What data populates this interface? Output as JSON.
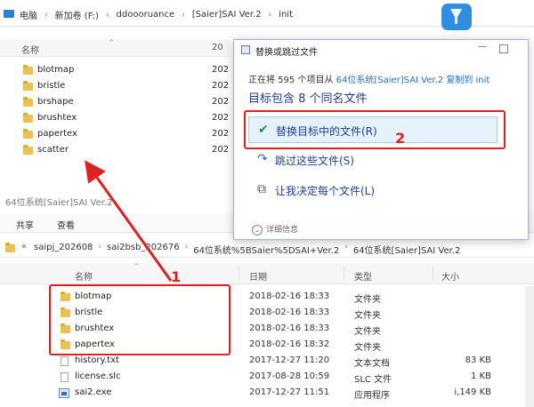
{
  "top_window": {
    "breadcrumb": [
      "电脑",
      "新加卷 (F:)",
      "ddoooruance",
      "[Saier]SAI Ver.2",
      "init"
    ],
    "header": {
      "name": "名称",
      "date": "20"
    },
    "rows": [
      {
        "name": "blotmap",
        "date": "202"
      },
      {
        "name": "bristle",
        "date": "202"
      },
      {
        "name": "brshape",
        "date": "202"
      },
      {
        "name": "brushtex",
        "date": "202"
      },
      {
        "name": "papertex",
        "date": "202"
      },
      {
        "name": "scatter",
        "date": "202"
      }
    ]
  },
  "bottom_window": {
    "title": "64位系统[Saier]SAI Ver.2",
    "ribbon_tabs": [
      "共享",
      "查看"
    ],
    "breadcrumb": [
      "saipj_202608",
      "sai2bsb_202676",
      "64位系统%5BSaier%5DSAI+Ver.2",
      "64位系统[Saier]SAI Ver.2"
    ],
    "headers": {
      "name": "名称",
      "date": "日期",
      "type": "类型",
      "size": "大小"
    },
    "rows": [
      {
        "name": "blotmap",
        "date": "2018-02-16 18:33",
        "type": "文件夹",
        "size": "",
        "kind": "folder"
      },
      {
        "name": "bristle",
        "date": "2018-02-16 18:33",
        "type": "文件夹",
        "size": "",
        "kind": "folder"
      },
      {
        "name": "brushtex",
        "date": "2018-02-16 18:33",
        "type": "文件夹",
        "size": "",
        "kind": "folder"
      },
      {
        "name": "papertex",
        "date": "2018-02-16 18:32",
        "type": "文件夹",
        "size": "",
        "kind": "folder"
      },
      {
        "name": "history.txt",
        "date": "2017-12-27 11:20",
        "type": "文本文档",
        "size": "83 KB",
        "kind": "file"
      },
      {
        "name": "license.slc",
        "date": "2017-08-28 10:59",
        "type": "SLC 文件",
        "size": "1 KB",
        "kind": "file"
      },
      {
        "name": "sai2.exe",
        "date": "2017-12-27 11:51",
        "type": "应用程序",
        "size": "i,149 KB",
        "kind": "exe"
      }
    ]
  },
  "dialog": {
    "title": "替换或跳过文件",
    "progress_prefix": "正在将 595 个项目从",
    "progress_source": "64位系统[Saier]SAI Ver.2",
    "progress_suffix": "复制到 init",
    "heading": "目标包含 8 个同名文件",
    "options": [
      {
        "label": "替换目标中的文件(R)",
        "icon": "check-icon"
      },
      {
        "label": "跳过这些文件(S)",
        "icon": "skip-icon"
      },
      {
        "label": "让我决定每个文件(L)",
        "icon": "decide-icon"
      }
    ],
    "details": "详细信息",
    "minimize": "—"
  },
  "annotations": {
    "one": "1",
    "two": "2",
    "color": "#e02020"
  }
}
